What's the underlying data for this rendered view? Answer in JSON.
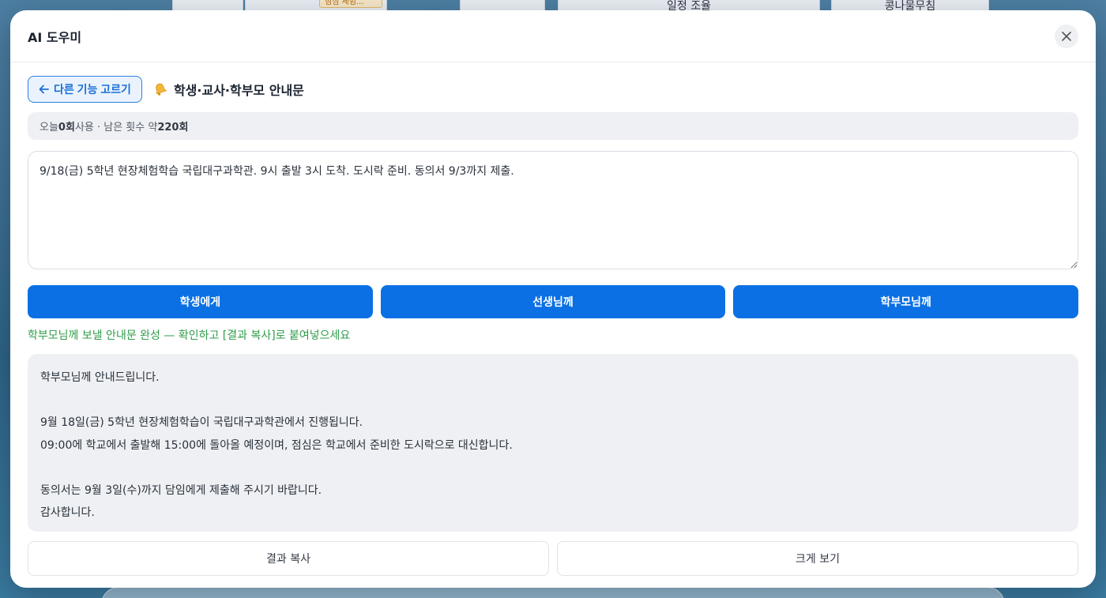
{
  "background": {
    "cards": [
      "",
      "",
      "",
      "일정 조율",
      "콩나물무침"
    ],
    "chip": "점심 체험..."
  },
  "modal": {
    "title": "AI 도우미",
    "close_icon": "close-icon"
  },
  "topbar": {
    "back_label": "다른 기능 고르기",
    "back_icon": "arrow-left-icon",
    "feature_icon": "bell-icon",
    "feature_title": "학생·교사·학부모 안내문"
  },
  "usage": {
    "prefix": "오늘 ",
    "used": "0회",
    "middle": " 사용 · 남은 횟수 약 ",
    "remaining": "220회"
  },
  "input": {
    "value": "9/18(금) 5학년 현장체험학습 국립대구과학관. 9시 출발 3시 도착. 도시락 준비. 동의서 9/3까지 제출."
  },
  "audience_buttons": [
    "학생에게",
    "선생님께",
    "학부모님께"
  ],
  "status": {
    "message": "학부모님께 보낼 안내문 완성 — 확인하고 [결과 복사]로 붙여넣으세요",
    "color": "#2f9d4a"
  },
  "result": {
    "lines": [
      "학부모님께 안내드립니다.",
      "",
      "9월 18일(금) 5학년 현장체험학습이 국립대구과학관에서 진행됩니다.",
      "09:00에 학교에서 출발해 15:00에 돌아올 예정이며, 점심은 학교에서 준비한 도시락으로 대신합니다.",
      "",
      "동의서는 9월 3일(수)까지 담임에게 제출해 주시기 바랍니다.",
      "감사합니다."
    ]
  },
  "actions": {
    "copy_label": "결과 복사",
    "expand_label": "크게 보기"
  },
  "colors": {
    "primary": "#0a70e4",
    "back_border": "#2c7ee0",
    "success": "#2f9d4a"
  }
}
